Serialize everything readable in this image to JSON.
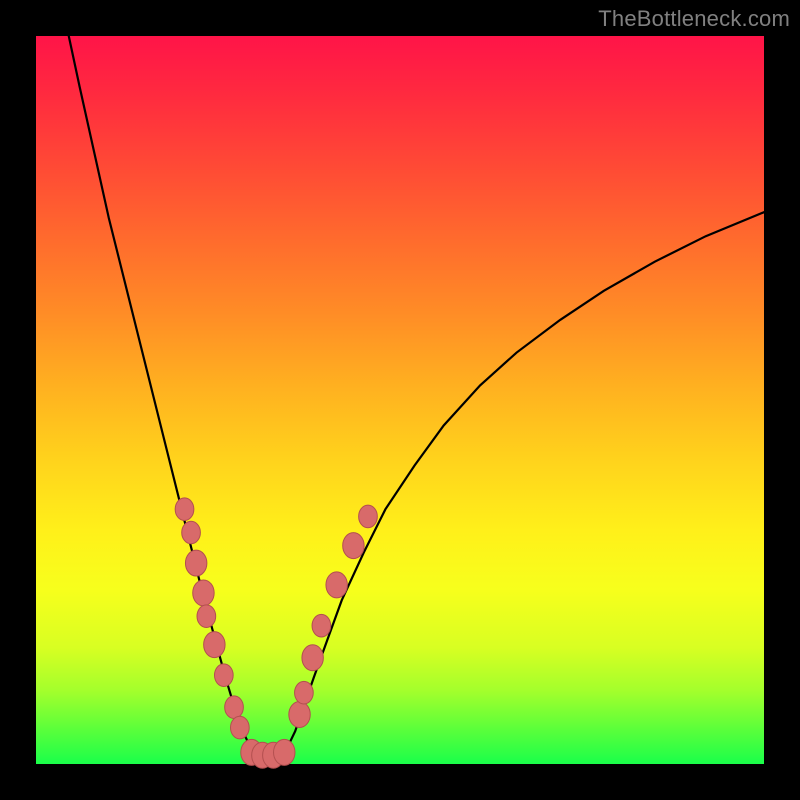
{
  "watermark": "TheBottleneck.com",
  "colors": {
    "frame": "#000000",
    "watermark": "#808080",
    "dot_fill": "#d86a6a",
    "dot_stroke": "#b34f4f",
    "curve": "#000000"
  },
  "chart_data": {
    "type": "line",
    "title": "",
    "xlabel": "",
    "ylabel": "",
    "xlim": [
      0,
      100
    ],
    "ylim": [
      0,
      100
    ],
    "grid": false,
    "curve_left": {
      "x": [
        4.5,
        6,
        8,
        10,
        12,
        14,
        16,
        18,
        20,
        21.5,
        23,
        24.5,
        26,
        27.2,
        28.4,
        29.6,
        30.6
      ],
      "y": [
        100,
        93,
        84,
        75,
        67,
        59,
        51,
        43,
        35,
        29,
        23,
        17.5,
        12,
        8,
        4.5,
        2,
        0.6
      ]
    },
    "curve_right": {
      "x": [
        33.4,
        34.4,
        35.6,
        36.8,
        38.2,
        40,
        42,
        45,
        48,
        52,
        56,
        61,
        66,
        72,
        78,
        85,
        92,
        100
      ],
      "y": [
        0.6,
        2,
        4.5,
        8,
        12,
        17,
        22.5,
        29,
        35,
        41,
        46.5,
        52,
        56.5,
        61,
        65,
        69,
        72.5,
        75.8
      ]
    },
    "floor": {
      "x": [
        30.6,
        31.3,
        32.0,
        32.7,
        33.4
      ],
      "y": [
        0.6,
        0.5,
        0.5,
        0.5,
        0.6
      ]
    },
    "dots_left": [
      {
        "x": 20.4,
        "y": 35.0,
        "r": 1.35
      },
      {
        "x": 21.3,
        "y": 31.8,
        "r": 1.35
      },
      {
        "x": 22.0,
        "y": 27.6,
        "r": 1.55
      },
      {
        "x": 23.0,
        "y": 23.5,
        "r": 1.55
      },
      {
        "x": 23.4,
        "y": 20.3,
        "r": 1.35
      },
      {
        "x": 24.5,
        "y": 16.4,
        "r": 1.55
      },
      {
        "x": 25.8,
        "y": 12.2,
        "r": 1.35
      },
      {
        "x": 27.2,
        "y": 7.8,
        "r": 1.35
      },
      {
        "x": 28.0,
        "y": 5.0,
        "r": 1.35
      }
    ],
    "dots_right": [
      {
        "x": 36.2,
        "y": 6.8,
        "r": 1.55
      },
      {
        "x": 36.8,
        "y": 9.8,
        "r": 1.35
      },
      {
        "x": 38.0,
        "y": 14.6,
        "r": 1.55
      },
      {
        "x": 39.2,
        "y": 19.0,
        "r": 1.35
      },
      {
        "x": 41.3,
        "y": 24.6,
        "r": 1.55
      },
      {
        "x": 43.6,
        "y": 30.0,
        "r": 1.55
      },
      {
        "x": 45.6,
        "y": 34.0,
        "r": 1.35
      }
    ],
    "dots_bottom": [
      {
        "x": 29.6,
        "y": 1.6,
        "r": 1.55
      },
      {
        "x": 31.1,
        "y": 1.2,
        "r": 1.55
      },
      {
        "x": 32.6,
        "y": 1.2,
        "r": 1.55
      },
      {
        "x": 34.1,
        "y": 1.6,
        "r": 1.55
      }
    ]
  }
}
